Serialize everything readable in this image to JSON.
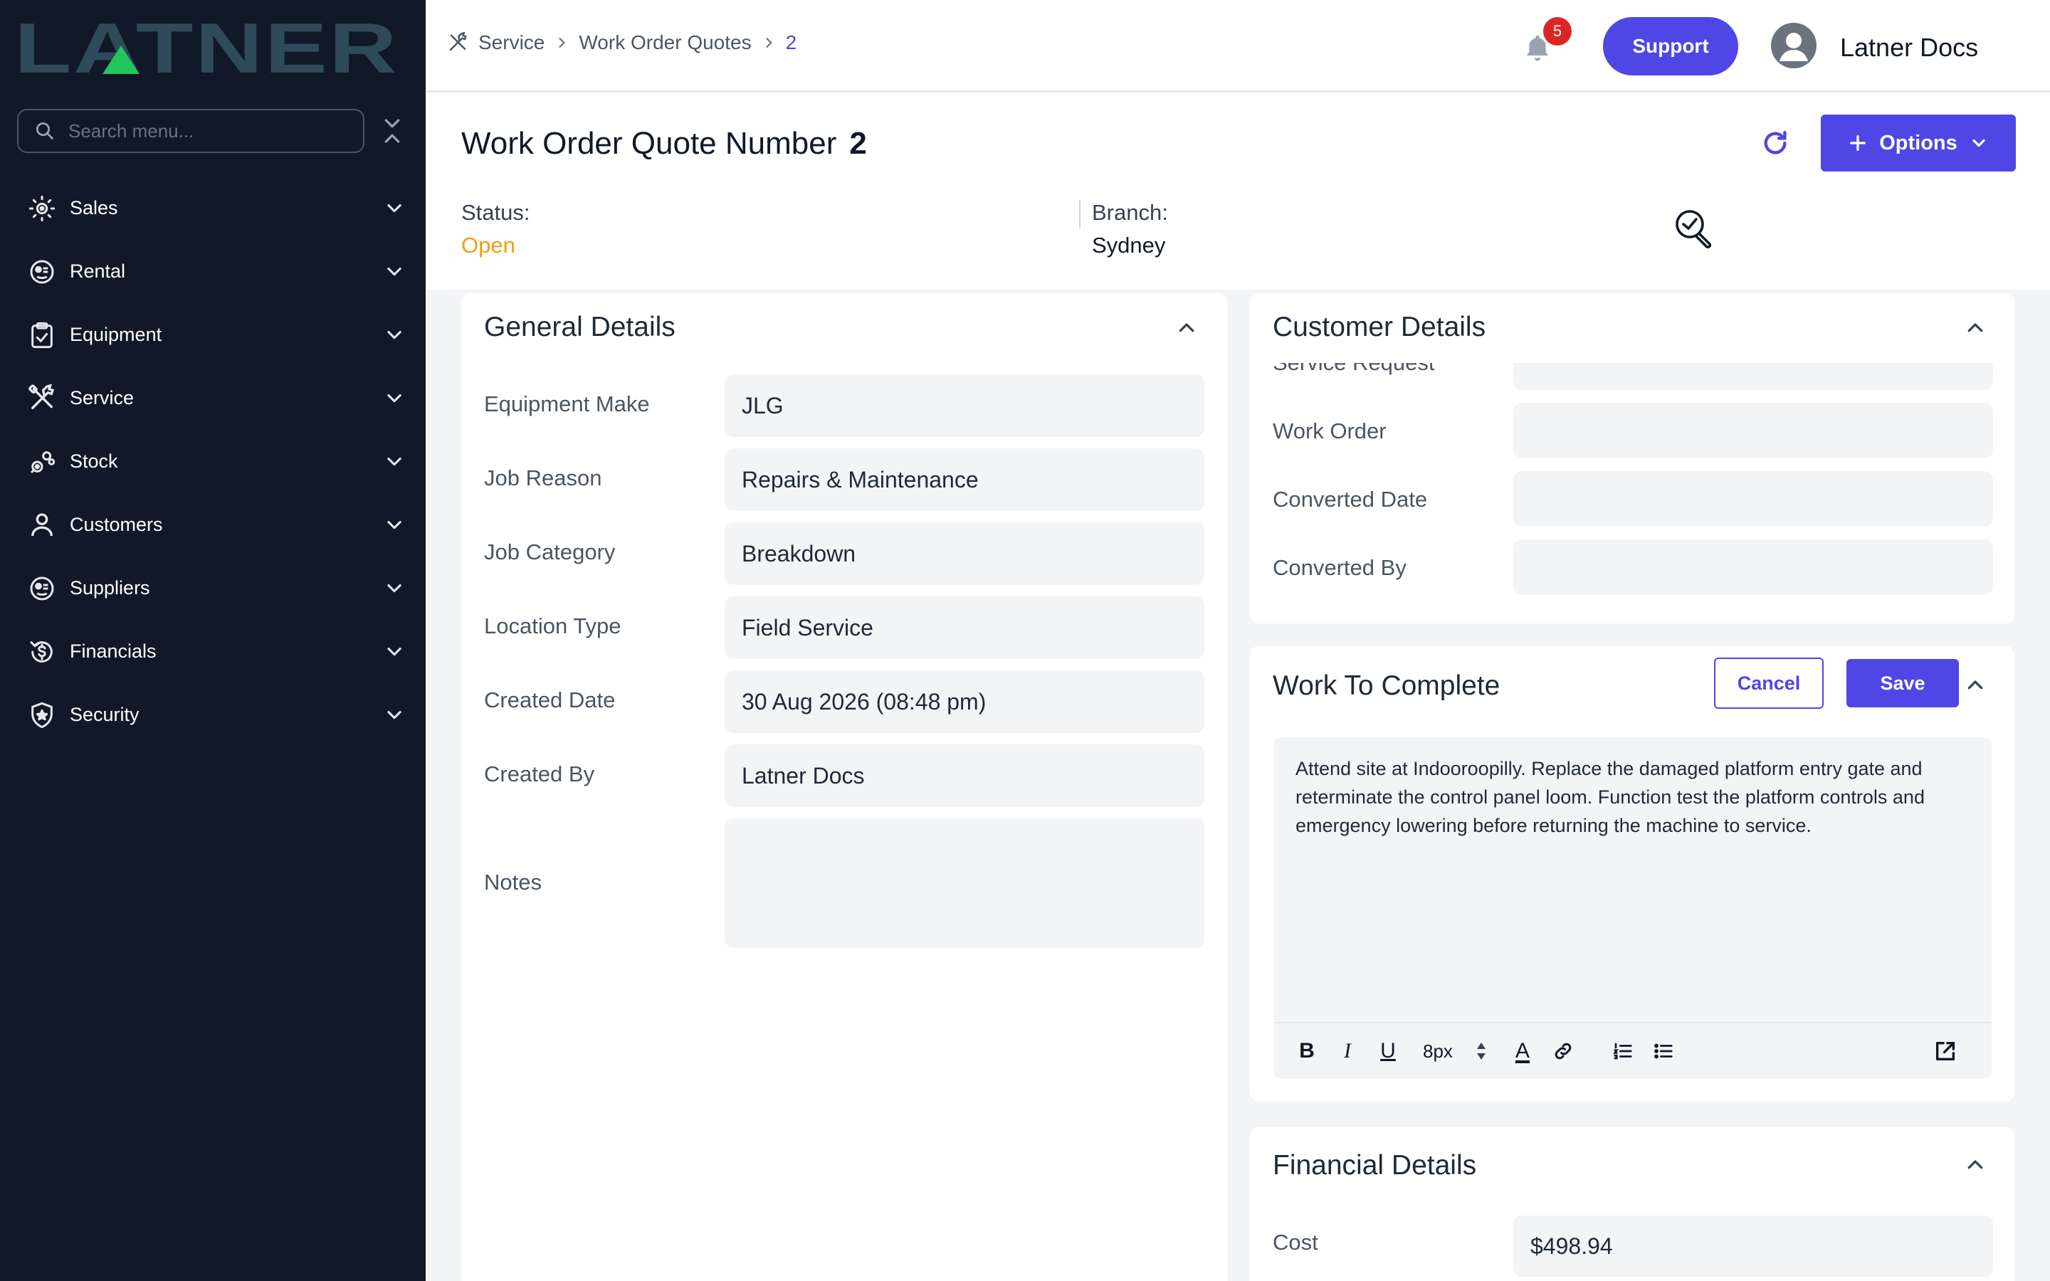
{
  "brand": {
    "logo_text": "LATNER",
    "logo_color": "#2f4a5a",
    "logo_accent": "#22c55e"
  },
  "sidebar": {
    "search_placeholder": "Search menu...",
    "items": [
      {
        "label": "Sales",
        "icon": "sales-icon"
      },
      {
        "label": "Rental",
        "icon": "rental-icon"
      },
      {
        "label": "Equipment",
        "icon": "clipboard-icon"
      },
      {
        "label": "Service",
        "icon": "tools-icon"
      },
      {
        "label": "Stock",
        "icon": "gears-icon"
      },
      {
        "label": "Customers",
        "icon": "user-icon"
      },
      {
        "label": "Suppliers",
        "icon": "suppliers-icon"
      },
      {
        "label": "Financials",
        "icon": "dollar-icon"
      },
      {
        "label": "Security",
        "icon": "shield-icon"
      }
    ]
  },
  "header": {
    "breadcrumb": [
      "Service",
      "Work Order Quotes",
      "2"
    ],
    "notifications": "5",
    "support_label": "Support",
    "user_name": "Latner Docs"
  },
  "title": {
    "label": "Work Order Quote Number",
    "number": "2",
    "options_label": "Options",
    "status_label": "Status:",
    "status_value": "Open",
    "branch_label": "Branch:",
    "branch_value": "Sydney"
  },
  "general": {
    "title": "General Details",
    "fields": [
      {
        "label": "Equipment Make",
        "value": "JLG"
      },
      {
        "label": "Job Reason",
        "value": "Repairs & Maintenance"
      },
      {
        "label": "Job Category",
        "value": "Breakdown"
      },
      {
        "label": "Location Type",
        "value": "Field Service"
      },
      {
        "label": "Created Date",
        "value": "30 Aug 2026 (08:48 pm)"
      },
      {
        "label": "Created By",
        "value": "Latner Docs"
      },
      {
        "label": "Notes",
        "value": ""
      }
    ]
  },
  "customer": {
    "title": "Customer Details",
    "fields": [
      {
        "label": "Service Request",
        "value": ""
      },
      {
        "label": "Work Order",
        "value": ""
      },
      {
        "label": "Converted Date",
        "value": ""
      },
      {
        "label": "Converted By",
        "value": ""
      }
    ]
  },
  "work": {
    "title": "Work To Complete",
    "cancel_label": "Cancel",
    "save_label": "Save",
    "text": "Attend site at Indooroopilly. Replace the damaged platform entry gate and reterminate the control panel loom. Function test the platform controls and emergency lowering before returning the machine to service.",
    "toolbar": {
      "bold": "B",
      "italic": "I",
      "underline": "U",
      "font_size": "8px",
      "text_color": "A"
    }
  },
  "financial": {
    "title": "Financial Details",
    "fields": [
      {
        "label": "Cost",
        "value": "$498.94"
      }
    ]
  }
}
